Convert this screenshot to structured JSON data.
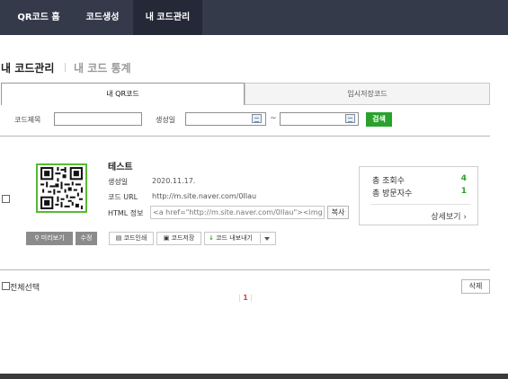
{
  "nav": {
    "items": [
      {
        "label": "QR코드 홈"
      },
      {
        "label": "코드생성"
      },
      {
        "label": "내 코드관리"
      }
    ],
    "active_index": 2
  },
  "page": {
    "title": "내 코드관리",
    "alt_title": "내 코드 통계"
  },
  "tabs": [
    {
      "label": "내 QR코드",
      "active": true
    },
    {
      "label": "임시저장코드",
      "active": false
    }
  ],
  "search": {
    "code_title_label": "코드제목",
    "code_title_value": "",
    "created_label": "생성일",
    "date_from": "",
    "date_to": "",
    "range_separator": "~",
    "button": "검색"
  },
  "code_item": {
    "title": "테스트",
    "created_label": "생성일",
    "created_value": "2020.11.17.",
    "url_label": "코드 URL",
    "url_value": "http://m.site.naver.com/0IIau",
    "html_label": "HTML 정보",
    "html_value": "<a href=\"http://m.site.naver.com/0Ilau\"><img src=",
    "copy_button": "복사",
    "preview_button": "미리보기",
    "edit_button": "수정",
    "print_button": "코드인쇄",
    "save_button": "코드저장",
    "export_button": "코드 내보내기",
    "stats": {
      "total_views_label": "총 조회수",
      "total_views_value": "4",
      "total_visitors_label": "총 방문자수",
      "total_visitors_value": "1",
      "detail_link": "상세보기"
    }
  },
  "footer": {
    "select_all": "전체선택",
    "delete_button": "삭제",
    "pages": [
      "1"
    ],
    "current_page": "1"
  },
  "colors": {
    "nav_bg": "#353a4b",
    "nav_active_bg": "#252836",
    "accent_green": "#29a22c",
    "page_current": "#e04141"
  },
  "icons": [
    "magnifier-icon",
    "calendar-icon",
    "printer-icon",
    "save-icon",
    "download-icon",
    "chevron-down-icon",
    "chevron-right-icon"
  ]
}
